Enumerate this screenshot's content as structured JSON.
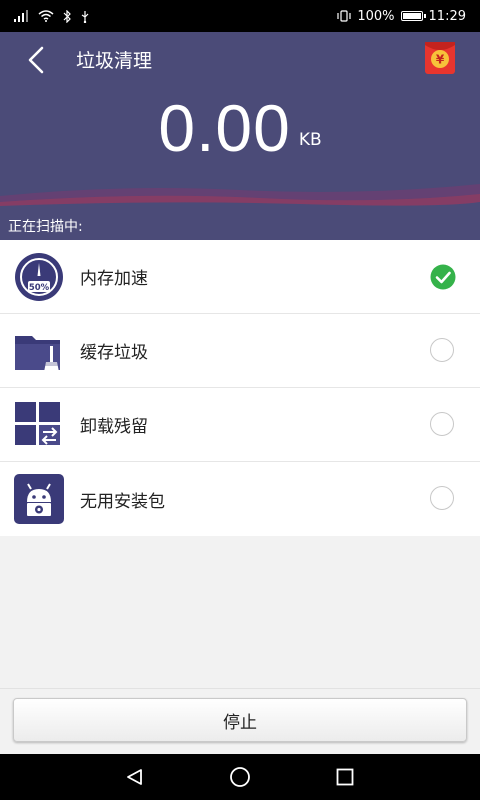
{
  "status_bar": {
    "battery": "100%",
    "time": "11:29"
  },
  "header": {
    "title": "垃圾清理",
    "size_value": "0.00",
    "size_unit": "KB"
  },
  "scan_status": "正在扫描中:",
  "items": [
    {
      "label": "内存加速",
      "icon": "memory-speedup-icon",
      "icon_text": "50%",
      "status": "done"
    },
    {
      "label": "缓存垃圾",
      "icon": "cache-trash-icon",
      "status": "pending"
    },
    {
      "label": "卸载残留",
      "icon": "uninstall-residue-icon",
      "status": "pending"
    },
    {
      "label": "无用安装包",
      "icon": "useless-apk-icon",
      "status": "pending"
    }
  ],
  "stop_button": "停止",
  "colors": {
    "header_bg": "#4b4b78",
    "icon_bg": "#3a3a78",
    "check_green": "#35b24a"
  }
}
